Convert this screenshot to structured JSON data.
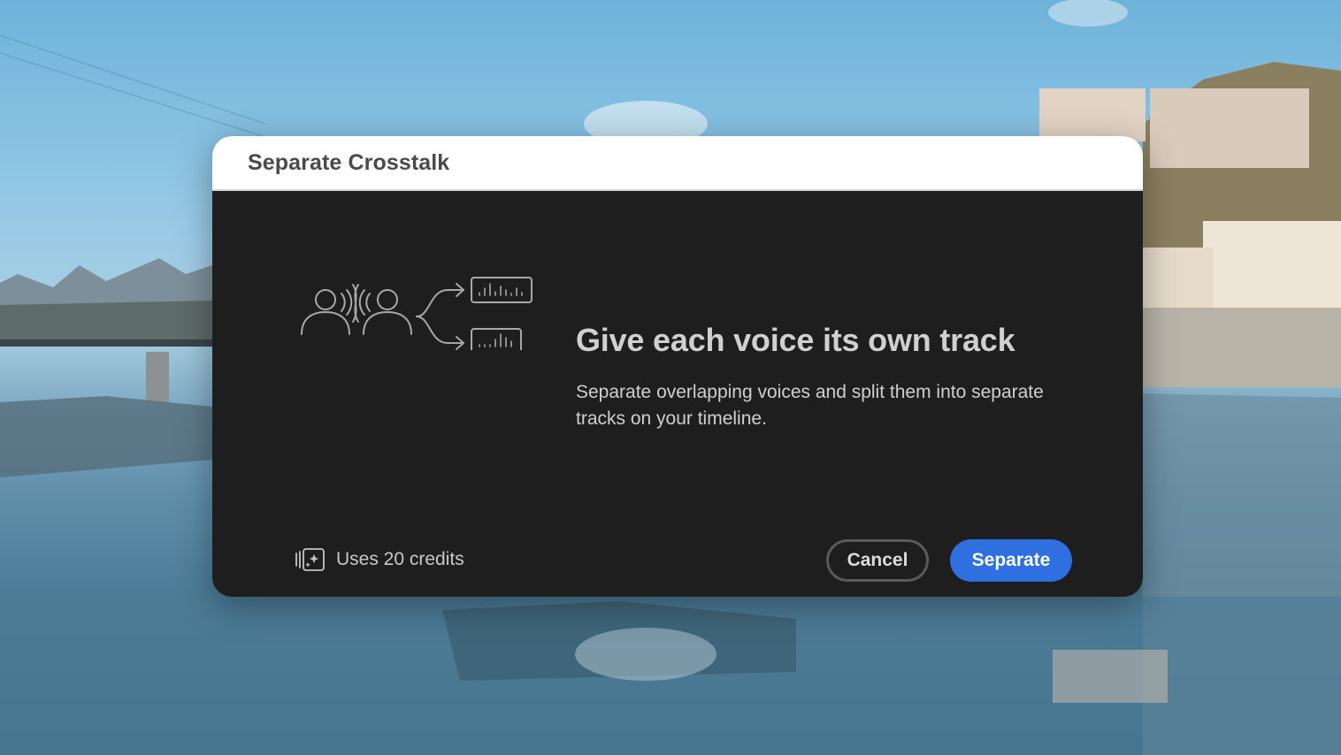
{
  "dialog": {
    "title": "Separate Crosstalk",
    "headline": "Give each voice its own track",
    "description": "Separate overlapping voices and split them into separate tracks on your timeline.",
    "illustration_icon": "crosstalk-split-illustration",
    "credits": {
      "icon": "generative-credits-icon",
      "label": "Uses 20 credits"
    },
    "buttons": {
      "cancel_label": "Cancel",
      "primary_label": "Separate"
    }
  },
  "colors": {
    "primary_button": "#2f6fe0",
    "dialog_background": "#1e1e1e",
    "header_background": "#ffffff"
  }
}
